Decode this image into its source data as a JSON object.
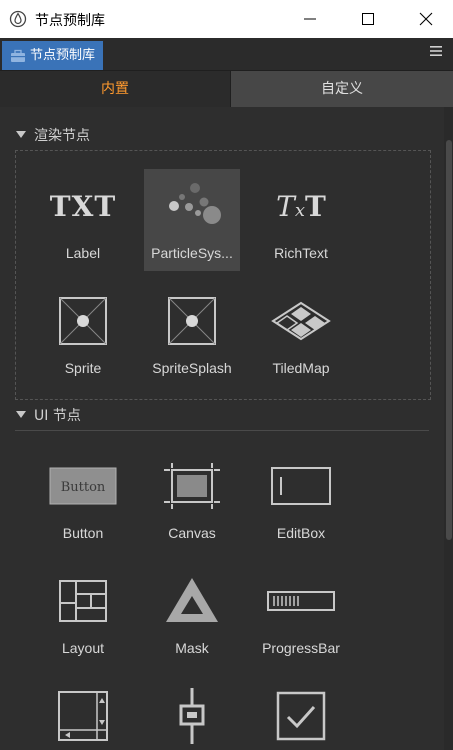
{
  "window": {
    "title": "节点预制库",
    "controls": [
      "minimize-icon",
      "maximize-icon",
      "close-icon"
    ]
  },
  "panel": {
    "tab_label": "节点预制库",
    "menu_icon": "hamburger-icon"
  },
  "tabs": [
    {
      "label": "内置",
      "active": true
    },
    {
      "label": "自定义",
      "active": false
    }
  ],
  "sections": {
    "render": {
      "title": "渲染节点",
      "items": [
        {
          "label": "Label",
          "icon": "label-txt-icon"
        },
        {
          "label": "ParticleSys...",
          "icon": "particle-system-icon",
          "selected": true
        },
        {
          "label": "RichText",
          "icon": "richtext-icon"
        },
        {
          "label": "Sprite",
          "icon": "sprite-icon"
        },
        {
          "label": "SpriteSplash",
          "icon": "sprite-splash-icon"
        },
        {
          "label": "TiledMap",
          "icon": "tiledmap-icon"
        }
      ]
    },
    "ui": {
      "title": "UI 节点",
      "items": [
        {
          "label": "Button",
          "icon": "button-icon",
          "icon_text": "Button"
        },
        {
          "label": "Canvas",
          "icon": "canvas-icon"
        },
        {
          "label": "EditBox",
          "icon": "editbox-icon"
        },
        {
          "label": "Layout",
          "icon": "layout-icon"
        },
        {
          "label": "Mask",
          "icon": "mask-icon"
        },
        {
          "label": "ProgressBar",
          "icon": "progressbar-icon"
        },
        {
          "label": "",
          "icon": "scrollview-icon"
        },
        {
          "label": "",
          "icon": "slider-icon"
        },
        {
          "label": "",
          "icon": "toggle-icon"
        }
      ]
    }
  },
  "colors": {
    "accent_active_tab": "#ff9a2e",
    "panel_tab_bg": "#3a73b8",
    "background": "#2e2e2e"
  }
}
